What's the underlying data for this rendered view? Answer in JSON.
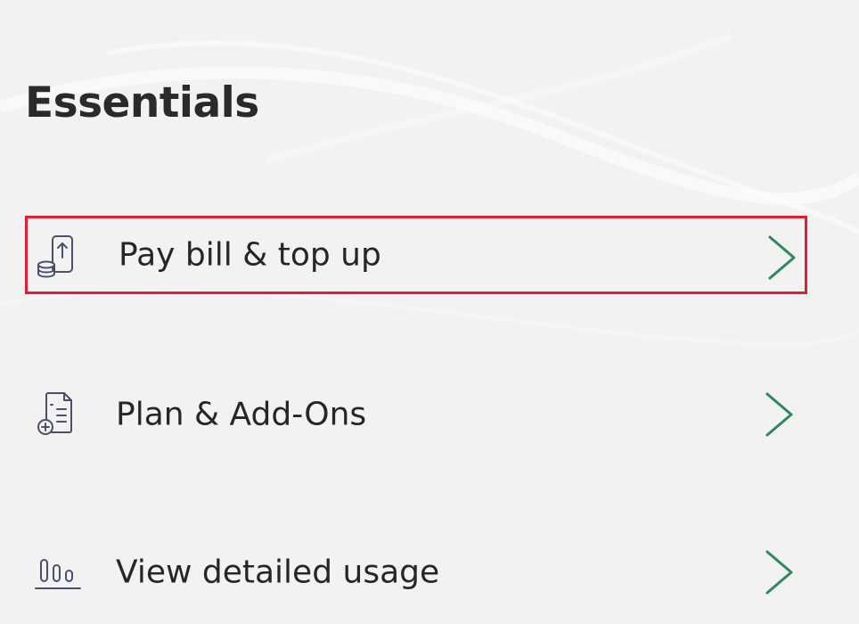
{
  "section": {
    "title": "Essentials"
  },
  "items": [
    {
      "label": "Pay bill & top up",
      "icon": "phone-payment-icon",
      "highlighted": true
    },
    {
      "label": "Plan & Add-Ons",
      "icon": "document-add-icon",
      "highlighted": false
    },
    {
      "label": "View detailed usage",
      "icon": "bar-chart-icon",
      "highlighted": false
    }
  ],
  "colors": {
    "chevron": "#2e8a5b",
    "highlight_border": "#e31c2f",
    "icon_stroke": "#4a5068",
    "text": "#262626"
  }
}
